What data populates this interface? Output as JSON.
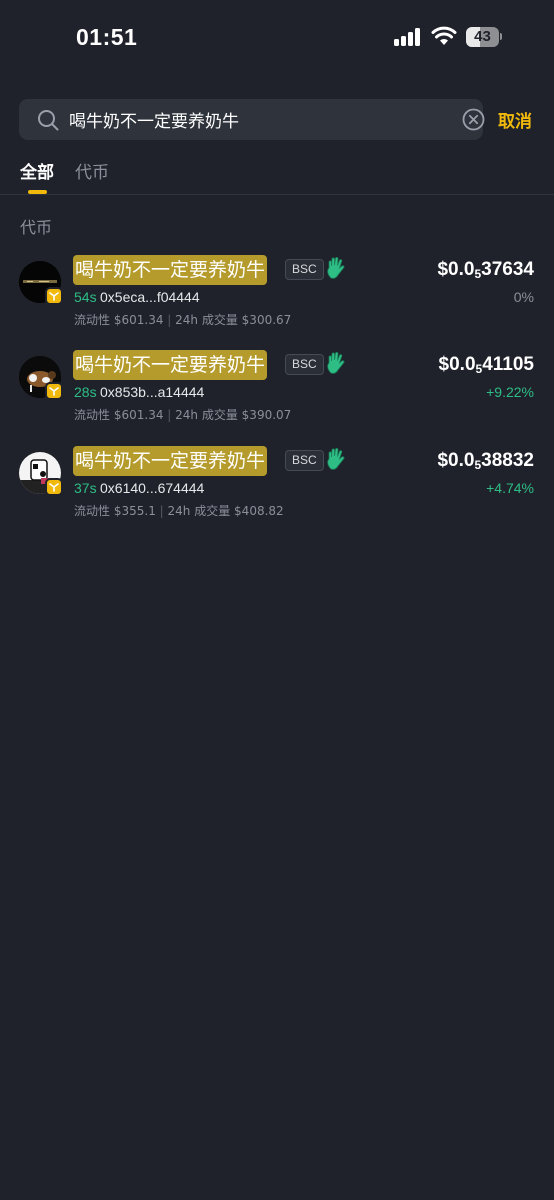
{
  "status_bar": {
    "time": "01:51",
    "battery": "43",
    "battery_level": 0.43
  },
  "search": {
    "value": "喝牛奶不一定要养奶牛",
    "placeholder": "",
    "cancel_label": "取消"
  },
  "tabs": [
    {
      "label": "全部",
      "active": true
    },
    {
      "label": "代币",
      "active": false
    }
  ],
  "section_title": "代币",
  "tokens": [
    {
      "name": "喝牛奶不一定要养奶牛",
      "chain": "BSC",
      "age": "54s",
      "address": "0x5eca...f04444",
      "liquidity_label": "流动性",
      "liquidity": "$601.34",
      "volume_label": "24h 成交量",
      "volume": "$300.67",
      "price_prefix": "$0.0",
      "price_zeros": "5",
      "price_digits": "37634",
      "change": "0%",
      "change_color": "#8a8f99"
    },
    {
      "name": "喝牛奶不一定要养奶牛",
      "chain": "BSC",
      "age": "28s",
      "address": "0x853b...a14444",
      "liquidity_label": "流动性",
      "liquidity": "$601.34",
      "volume_label": "24h 成交量",
      "volume": "$390.07",
      "price_prefix": "$0.0",
      "price_zeros": "5",
      "price_digits": "41105",
      "change": "+9.22%",
      "change_color": "#2ebd85"
    },
    {
      "name": "喝牛奶不一定要养奶牛",
      "chain": "BSC",
      "age": "37s",
      "address": "0x6140...674444",
      "liquidity_label": "流动性",
      "liquidity": "$355.1",
      "volume_label": "24h 成交量",
      "volume": "$408.82",
      "price_prefix": "$0.0",
      "price_zeros": "5",
      "price_digits": "38832",
      "change": "+4.74%",
      "change_color": "#2ebd85"
    }
  ],
  "colors": {
    "accent": "#f0b90b",
    "positive": "#2ebd85",
    "background": "#1f222b"
  }
}
